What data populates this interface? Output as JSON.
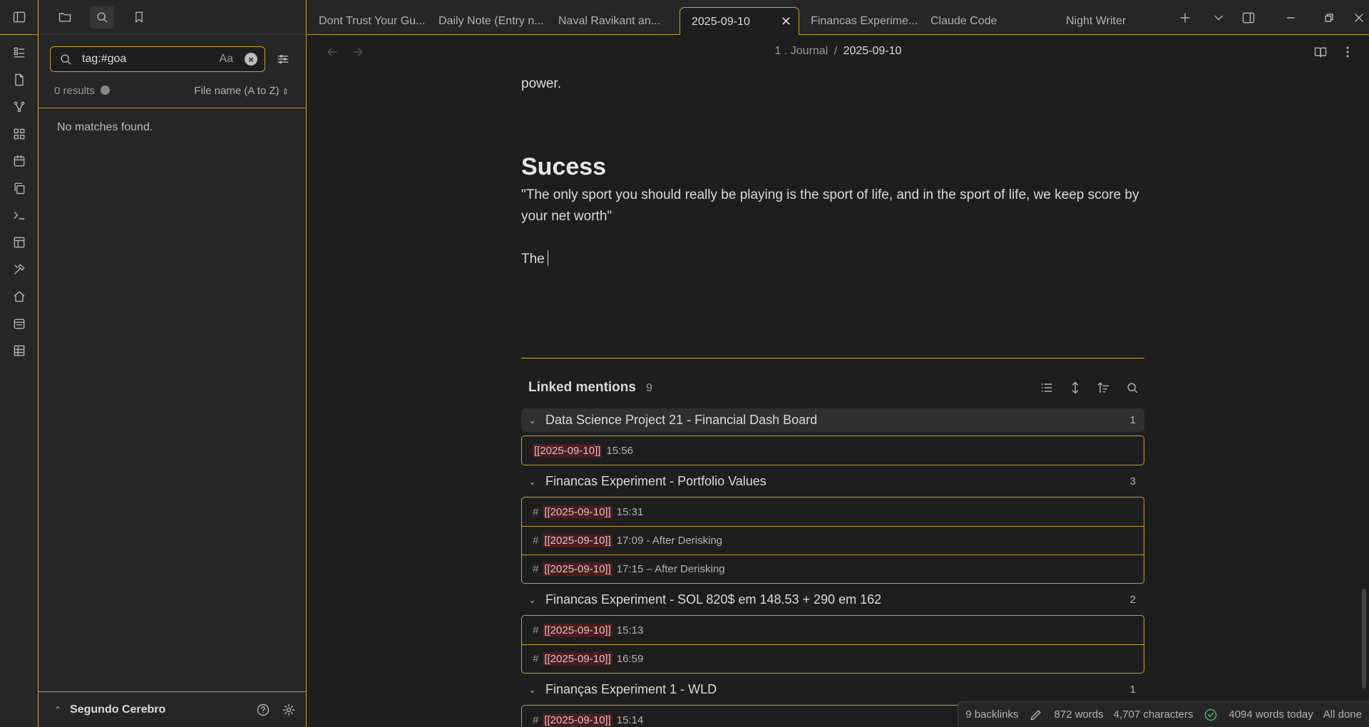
{
  "tabs": [
    {
      "label": "Dont Trust Your Gu..."
    },
    {
      "label": "Daily Note (Entry n..."
    },
    {
      "label": "Naval Ravikant an..."
    },
    {
      "label": "2025-09-10",
      "close": "✕"
    },
    {
      "label": "Financas Experime..."
    },
    {
      "label": "Claude Code"
    },
    {
      "label": "Night Writer"
    }
  ],
  "search": {
    "query": "tag:#goa",
    "match_case_label": "Aa",
    "results_text": "0 results",
    "sort_label": "File name (A to Z)",
    "empty_text": "No matches found."
  },
  "vault": {
    "name": "Segundo Cerebro"
  },
  "breadcrumb": {
    "folder": "1 . Journal",
    "separator": "/",
    "current": "2025-09-10"
  },
  "editor": {
    "cut_text": "power.",
    "heading": "Sucess",
    "quote": "\"The only sport you should really be playing is the sport of life, and in the sport of life, we keep score by your net worth\"",
    "typing": "The"
  },
  "linked_mentions": {
    "title": "Linked mentions",
    "count": "9",
    "groups": [
      {
        "title": "Data Science Project 21 - Financial Dash Board",
        "count": "1",
        "items": [
          {
            "hash": "",
            "link": "[[2025-09-10]]",
            "text": "15:56"
          }
        ]
      },
      {
        "title": "Financas Experiment - Portfolio Values",
        "count": "3",
        "items": [
          {
            "hash": "#",
            "link": "[[2025-09-10]]",
            "text": "15:31"
          },
          {
            "hash": "#",
            "link": "[[2025-09-10]]",
            "text": "17:09 - After Derisking"
          },
          {
            "hash": "#",
            "link": "[[2025-09-10]]",
            "text": "17:15 – After Derisking"
          }
        ]
      },
      {
        "title": "Financas Experiment - SOL 820$ em 148.53 + 290 em 162",
        "count": "2",
        "items": [
          {
            "hash": "#",
            "link": "[[2025-09-10]]",
            "text": "15:13"
          },
          {
            "hash": "#",
            "link": "[[2025-09-10]]",
            "text": "16:59"
          }
        ]
      },
      {
        "title": "Finanças Experiment 1 - WLD",
        "count": "1",
        "items": [
          {
            "hash": "#",
            "link": "[[2025-09-10]]",
            "text": "15:14"
          }
        ]
      }
    ]
  },
  "status": {
    "backlinks": "9 backlinks",
    "words": "872 words",
    "characters": "4,707 characters",
    "today": "4094 words today",
    "sync": "All done"
  },
  "colors": {
    "accent": "#c9a227",
    "background": "#1e1e1e",
    "panel": "#262626",
    "link_bg": "#4a1d1f"
  }
}
